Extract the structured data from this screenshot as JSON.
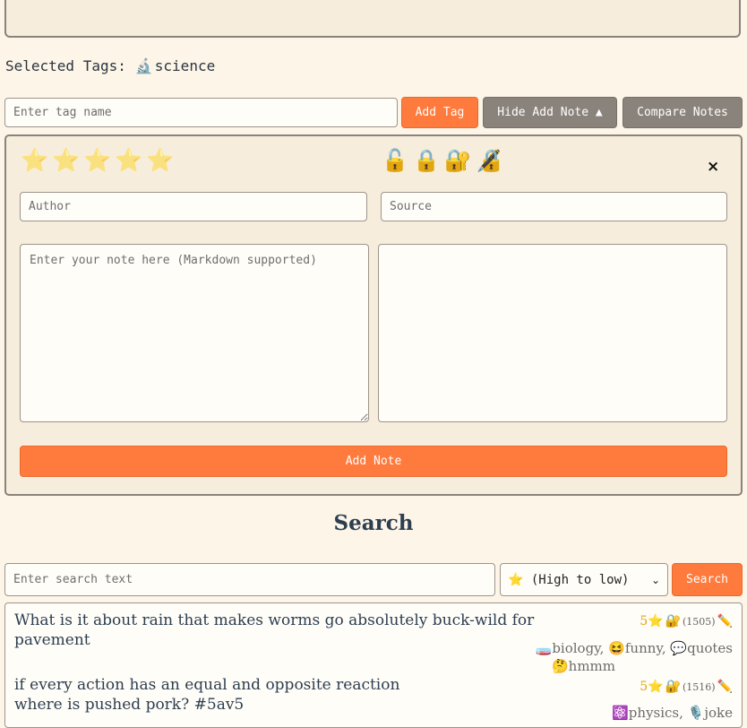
{
  "selected_tags": {
    "label": "Selected Tags:",
    "tags": [
      {
        "icon": "🔬",
        "name": "science"
      }
    ]
  },
  "tag_input": {
    "placeholder": "Enter tag name",
    "value": ""
  },
  "buttons": {
    "add_tag": "Add Tag",
    "hide_add_note": "Hide Add Note ▲",
    "compare_notes": "Compare Notes",
    "add_note": "Add Note",
    "search": "Search"
  },
  "add_note_form": {
    "stars": [
      "⭐",
      "⭐",
      "⭐",
      "⭐",
      "⭐"
    ],
    "locks": [
      "🔓",
      "🔒",
      "🔐",
      "🔏"
    ],
    "close": "×",
    "author_placeholder": "Author",
    "source_placeholder": "Source",
    "note_placeholder": "Enter your note here (Markdown supported)"
  },
  "search": {
    "title": "Search",
    "placeholder": "Enter search text",
    "sort_selected": "⭐ (High to low)"
  },
  "results": [
    {
      "text_line1": "What is it about rain that makes worms go absolutely buck-wild for",
      "text_line2": "pavement",
      "rating": "5⭐",
      "lock": "🔐",
      "id": "(1505)",
      "edit": "✏️",
      "tags_line1": "🧫biology, 😆funny, 💬quotes",
      "tags_line2": "🤔hmmm"
    },
    {
      "text_line1": "if every action has an equal and opposite reaction",
      "text_line2": "where is pushed pork? #5av5",
      "rating": "5⭐",
      "lock": "🔐",
      "id": "(1516)",
      "edit": "✏️",
      "tags_line1": "⚛️physics, 🎙️joke"
    }
  ],
  "colors": {
    "accent": "#ff7a3d",
    "secondary": "#8a837c",
    "background": "#fcf5e8",
    "panel": "#f7eddc"
  }
}
